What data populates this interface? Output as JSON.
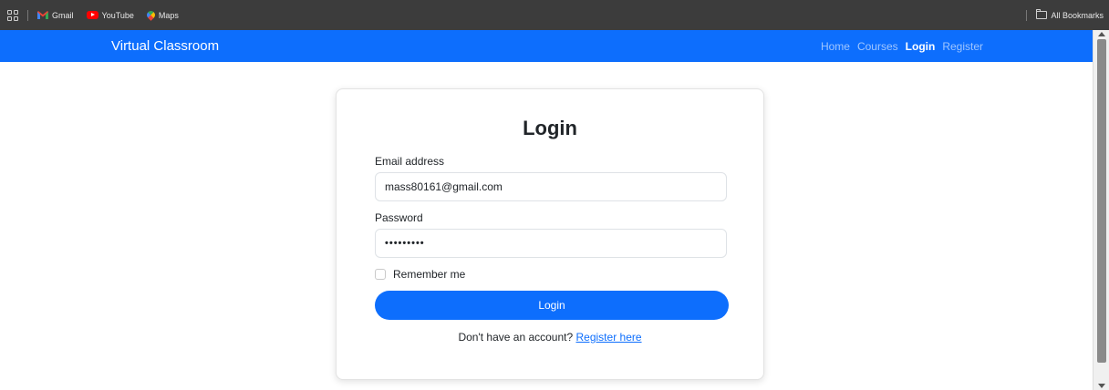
{
  "bookmarks": {
    "items": [
      {
        "label": "Gmail",
        "icon": "gmail-icon"
      },
      {
        "label": "YouTube",
        "icon": "youtube-icon"
      },
      {
        "label": "Maps",
        "icon": "maps-icon"
      }
    ],
    "all_bookmarks_label": "All Bookmarks"
  },
  "navbar": {
    "brand": "Virtual Classroom",
    "links": [
      {
        "label": "Home",
        "active": false
      },
      {
        "label": "Courses",
        "active": false
      },
      {
        "label": "Login",
        "active": true
      },
      {
        "label": "Register",
        "active": false
      }
    ],
    "color": "#0d6efd"
  },
  "login_form": {
    "title": "Login",
    "email_label": "Email address",
    "email_value": "mass80161@gmail.com",
    "password_label": "Password",
    "password_value": "•••••••••",
    "remember_label": "Remember me",
    "remember_checked": false,
    "submit_label": "Login",
    "register_prompt": "Don't have an account?",
    "register_link": "Register here"
  }
}
